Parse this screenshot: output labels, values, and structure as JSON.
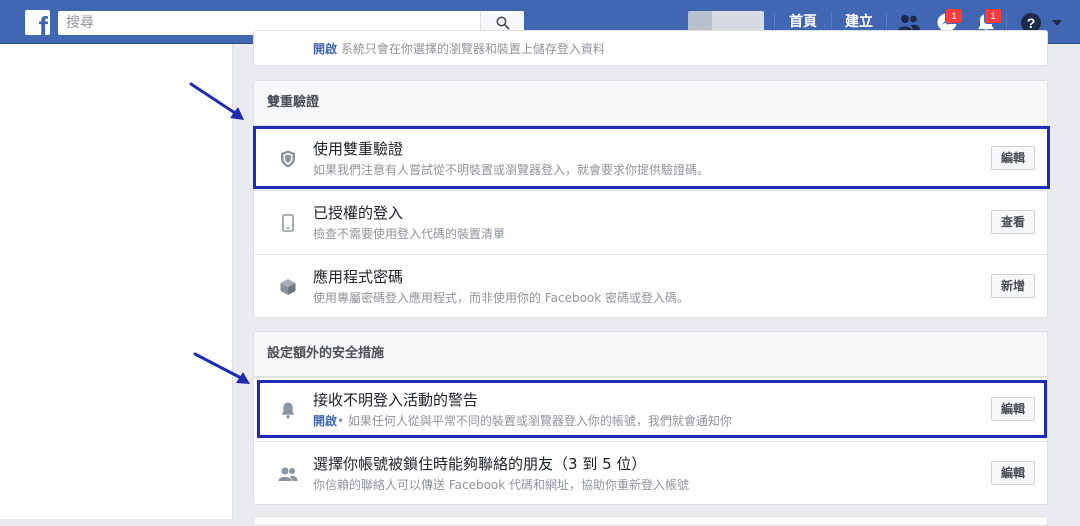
{
  "header": {
    "search_placeholder": "搜尋",
    "nav": {
      "home": "首頁",
      "create": "建立"
    },
    "badges": {
      "messages": "1",
      "notifications": "1"
    },
    "colors": {
      "bar": "#4267b2",
      "badge": "#fa3e3e"
    }
  },
  "top_card": {
    "status": "開啟",
    "text": "系統只會在你選擇的瀏覽器和裝置上儲存登入資料"
  },
  "two_factor": {
    "title": "雙重驗證",
    "rows": [
      {
        "icon": "shield-icon",
        "title": "使用雙重驗證",
        "desc": "如果我們注意有人嘗試從不明裝置或瀏覽器登入，就會要求你提供驗證碼。",
        "button": "編輯"
      },
      {
        "icon": "phone-icon",
        "title": "已授權的登入",
        "desc": "檢查不需要使用登入代碼的裝置清單",
        "button": "查看"
      },
      {
        "icon": "cube-icon",
        "title": "應用程式密碼",
        "desc": "使用專屬密碼登入應用程式，而非使用你的 Facebook 密碼或登入碼。",
        "button": "新增"
      }
    ]
  },
  "extra_security": {
    "title": "設定額外的安全措施",
    "rows": [
      {
        "icon": "bell-icon",
        "title": "接收不明登入活動的警告",
        "status": "開啟",
        "desc": "• 如果任何人從與平常不同的裝置或瀏覽器登入你的帳號，我們就會通知你",
        "button": "編輯"
      },
      {
        "icon": "friends-icon",
        "title": "選擇你帳號被鎖住時能夠聯絡的朋友（3 到 5 位）",
        "desc": "你信賴的聯絡人可以傳送 Facebook 代碼和網址，協助你重新登入帳號",
        "button": "編輯"
      }
    ]
  },
  "annotation_color": "#1f2bb5"
}
